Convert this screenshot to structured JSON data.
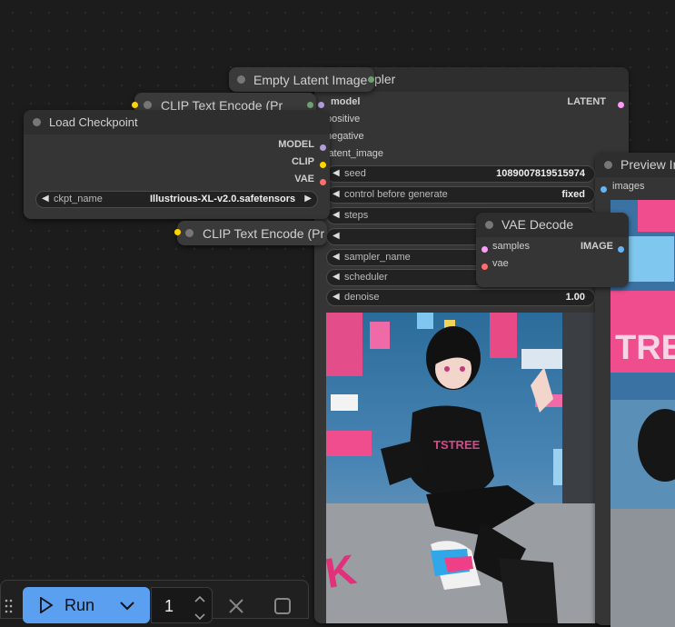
{
  "nodes": {
    "ksampler": {
      "title_fragment": "pler",
      "outputs": [
        "LATENT"
      ],
      "inputs": [
        "model",
        "positive",
        "negative",
        "latent_image"
      ],
      "widgets": [
        {
          "label": "seed",
          "value": "1089007819515974"
        },
        {
          "label": "control before generate",
          "value": "fixed"
        },
        {
          "label": "steps",
          "value": ""
        },
        {
          "label": "",
          "value": ""
        },
        {
          "label": "sampler_name",
          "value": ""
        },
        {
          "label": "scheduler",
          "value": ""
        },
        {
          "label": "denoise",
          "value": "1.00"
        }
      ]
    },
    "empty_latent": {
      "title": "Empty Latent Image"
    },
    "clip_top": {
      "title": "CLIP Text Encode (Pr"
    },
    "clip_bottom": {
      "title": "CLIP Text Encode (Pr"
    },
    "load_checkpoint": {
      "title": "Load Checkpoint",
      "outputs": [
        "MODEL",
        "CLIP",
        "VAE"
      ],
      "widget": {
        "label": "ckpt_name",
        "value": "Illustrious-XL-v2.0.safetensors"
      }
    },
    "preview": {
      "title": "Preview Im",
      "input": "images"
    },
    "vae_decode": {
      "title": "VAE Decode",
      "inputs": [
        "samples",
        "vae"
      ],
      "output": "IMAGE"
    }
  },
  "image_text": {
    "left_neon": "TSTREE",
    "right_neon": "TRE"
  },
  "toolbar": {
    "run_label": "Run",
    "batch_count": "1",
    "icons": {
      "drag": "drag-handle-icon",
      "play": "play-icon",
      "dropdown": "chevron-down-icon",
      "up": "chevron-up-icon",
      "down": "chevron-down-icon",
      "cancel": "close-icon",
      "stop": "stop-icon"
    }
  },
  "colors": {
    "canvas": "#1c1c1c",
    "node_body": "#353535",
    "node_title": "#2e2e2e",
    "model": "#b39ddb",
    "clip": "#ffd500",
    "vae": "#ff6e6e",
    "latent": "#ff9cf9",
    "image": "#64b5f6",
    "run_button": "#5a9ff0"
  }
}
